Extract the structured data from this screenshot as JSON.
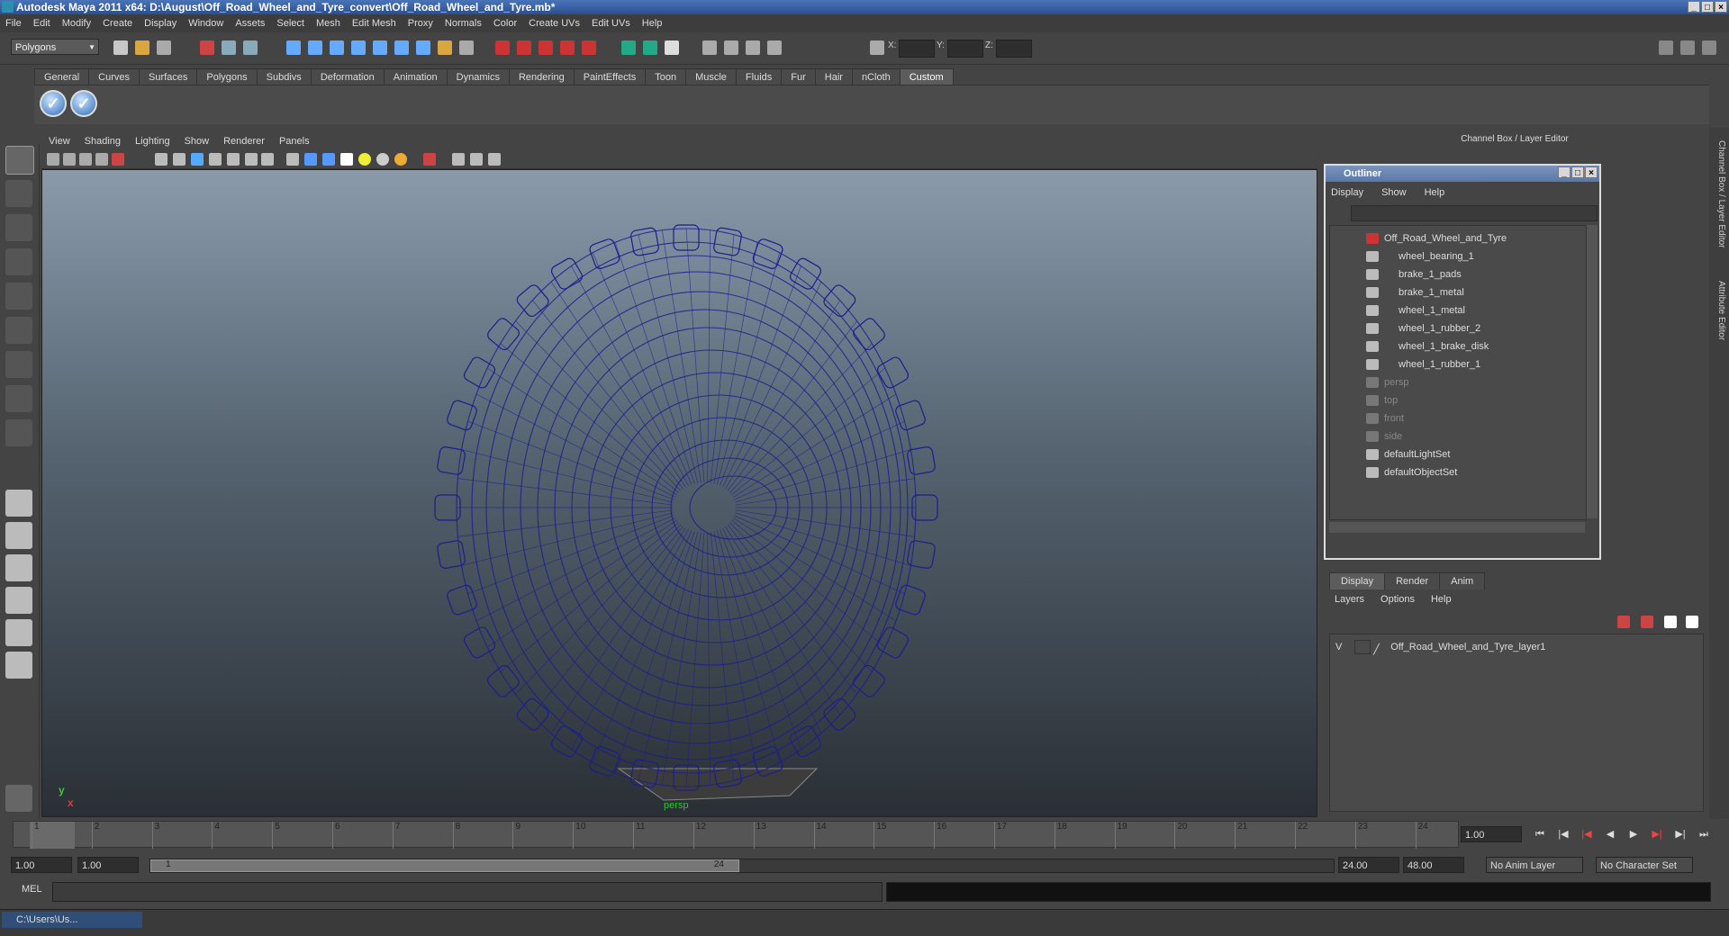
{
  "app": {
    "title": "Autodesk Maya 2011 x64: D:\\August\\Off_Road_Wheel_and_Tyre_convert\\Off_Road_Wheel_and_Tyre.mb*"
  },
  "menubar": [
    "File",
    "Edit",
    "Modify",
    "Create",
    "Display",
    "Window",
    "Assets",
    "Select",
    "Mesh",
    "Edit Mesh",
    "Proxy",
    "Normals",
    "Color",
    "Create UVs",
    "Edit UVs",
    "Help"
  ],
  "statusline": {
    "mode": "Polygons",
    "x_label": "X:",
    "y_label": "Y:",
    "z_label": "Z:"
  },
  "shelf": {
    "tabs": [
      "General",
      "Curves",
      "Surfaces",
      "Polygons",
      "Subdivs",
      "Deformation",
      "Animation",
      "Dynamics",
      "Rendering",
      "PaintEffects",
      "Toon",
      "Muscle",
      "Fluids",
      "Fur",
      "Hair",
      "nCloth",
      "Custom"
    ],
    "active_tab": "Custom",
    "buttons": [
      "check-icon",
      "check-icon"
    ]
  },
  "viewport": {
    "menu": [
      "View",
      "Shading",
      "Lighting",
      "Show",
      "Renderer",
      "Panels"
    ],
    "camera": "persp",
    "axis_y": "y",
    "axis_x": "x",
    "wire_color": "#1b1e8c"
  },
  "channel_box": {
    "header": "Channel Box / Layer Editor"
  },
  "outliner": {
    "title": "Outliner",
    "menu": [
      "Display",
      "Show",
      "Help"
    ],
    "items": [
      {
        "label": "Off_Road_Wheel_and_Tyre",
        "indent": 0,
        "dim": false
      },
      {
        "label": "wheel_bearing_1",
        "indent": 1,
        "dim": false
      },
      {
        "label": "brake_1_pads",
        "indent": 1,
        "dim": false
      },
      {
        "label": "brake_1_metal",
        "indent": 1,
        "dim": false
      },
      {
        "label": "wheel_1_metal",
        "indent": 1,
        "dim": false
      },
      {
        "label": "wheel_1_rubber_2",
        "indent": 1,
        "dim": false
      },
      {
        "label": "wheel_1_brake_disk",
        "indent": 1,
        "dim": false
      },
      {
        "label": "wheel_1_rubber_1",
        "indent": 1,
        "dim": false
      },
      {
        "label": "persp",
        "indent": 0,
        "dim": true
      },
      {
        "label": "top",
        "indent": 0,
        "dim": true
      },
      {
        "label": "front",
        "indent": 0,
        "dim": true
      },
      {
        "label": "side",
        "indent": 0,
        "dim": true
      },
      {
        "label": "defaultLightSet",
        "indent": 0,
        "dim": false
      },
      {
        "label": "defaultObjectSet",
        "indent": 0,
        "dim": false
      }
    ]
  },
  "layer_editor": {
    "tabs": [
      "Display",
      "Render",
      "Anim"
    ],
    "active_tab": "Display",
    "menu": [
      "Layers",
      "Options",
      "Help"
    ],
    "layer": {
      "visible": "V",
      "name": "Off_Road_Wheel_and_Tyre_layer1"
    }
  },
  "timeline": {
    "ticks": [
      "1",
      "2",
      "3",
      "4",
      "5",
      "6",
      "7",
      "8",
      "9",
      "10",
      "11",
      "12",
      "13",
      "14",
      "15",
      "16",
      "17",
      "18",
      "19",
      "20",
      "21",
      "22",
      "23",
      "24"
    ],
    "current_frame": "1.00"
  },
  "range": {
    "start": "1.00",
    "anim_start": "1.00",
    "slider_start": "1",
    "slider_end": "24",
    "anim_end": "24.00",
    "end": "48.00",
    "anim_layer": "No Anim Layer",
    "char_set": "No Character Set"
  },
  "mel": {
    "label": "MEL"
  },
  "taskbar": {
    "label": "C:\\Users\\Us..."
  },
  "side_tabs": [
    "Channel Box / Layer Editor",
    "Attribute Editor"
  ]
}
